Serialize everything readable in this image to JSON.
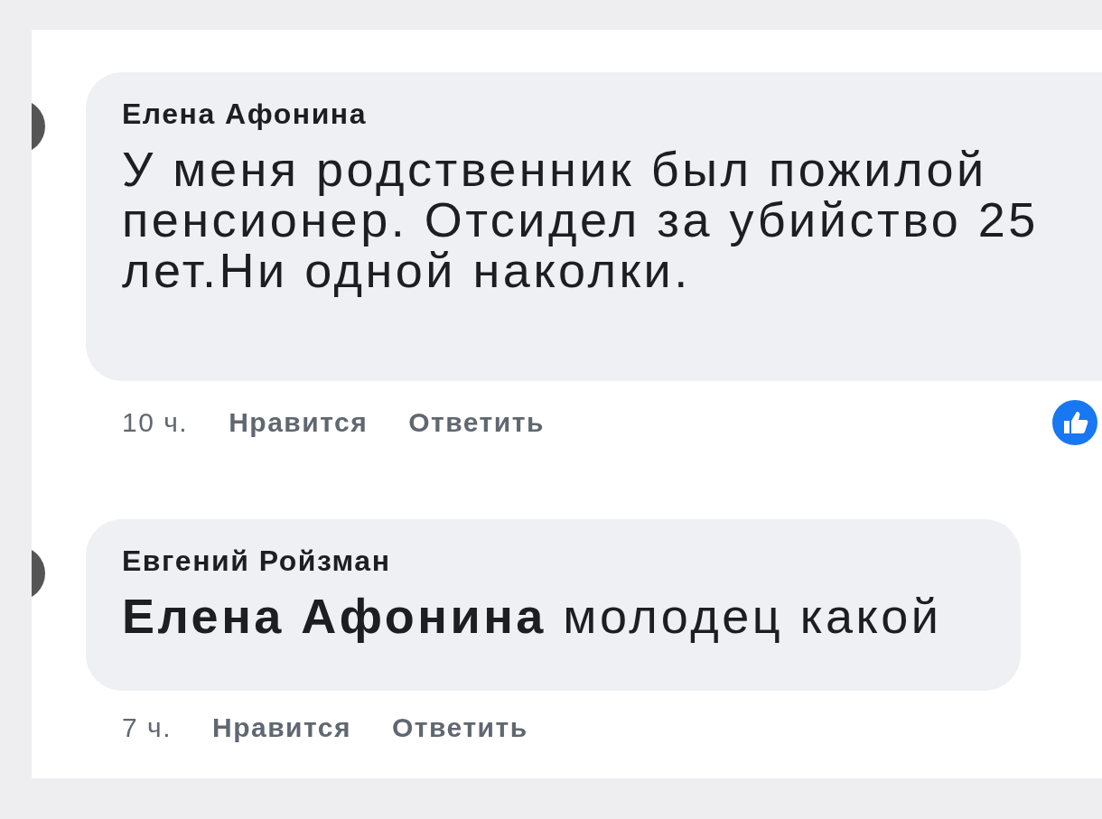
{
  "comments": [
    {
      "author": "Елена Афонина",
      "text_lines": [
        "У меня родственник был пожилой",
        "пенсионер. Отсидел за убийство 25",
        "лет.Ни одной наколки."
      ],
      "time": "10 ч.",
      "actions": [
        "Нравится",
        "Ответить"
      ],
      "has_reaction": true
    },
    {
      "author": "Евгений Ройзман",
      "text_lines": [
        "**Елена Афонина** молодец какой"
      ],
      "time": "7 ч.",
      "actions": [
        "Нравится",
        "Ответить"
      ],
      "has_reaction": false
    }
  ]
}
